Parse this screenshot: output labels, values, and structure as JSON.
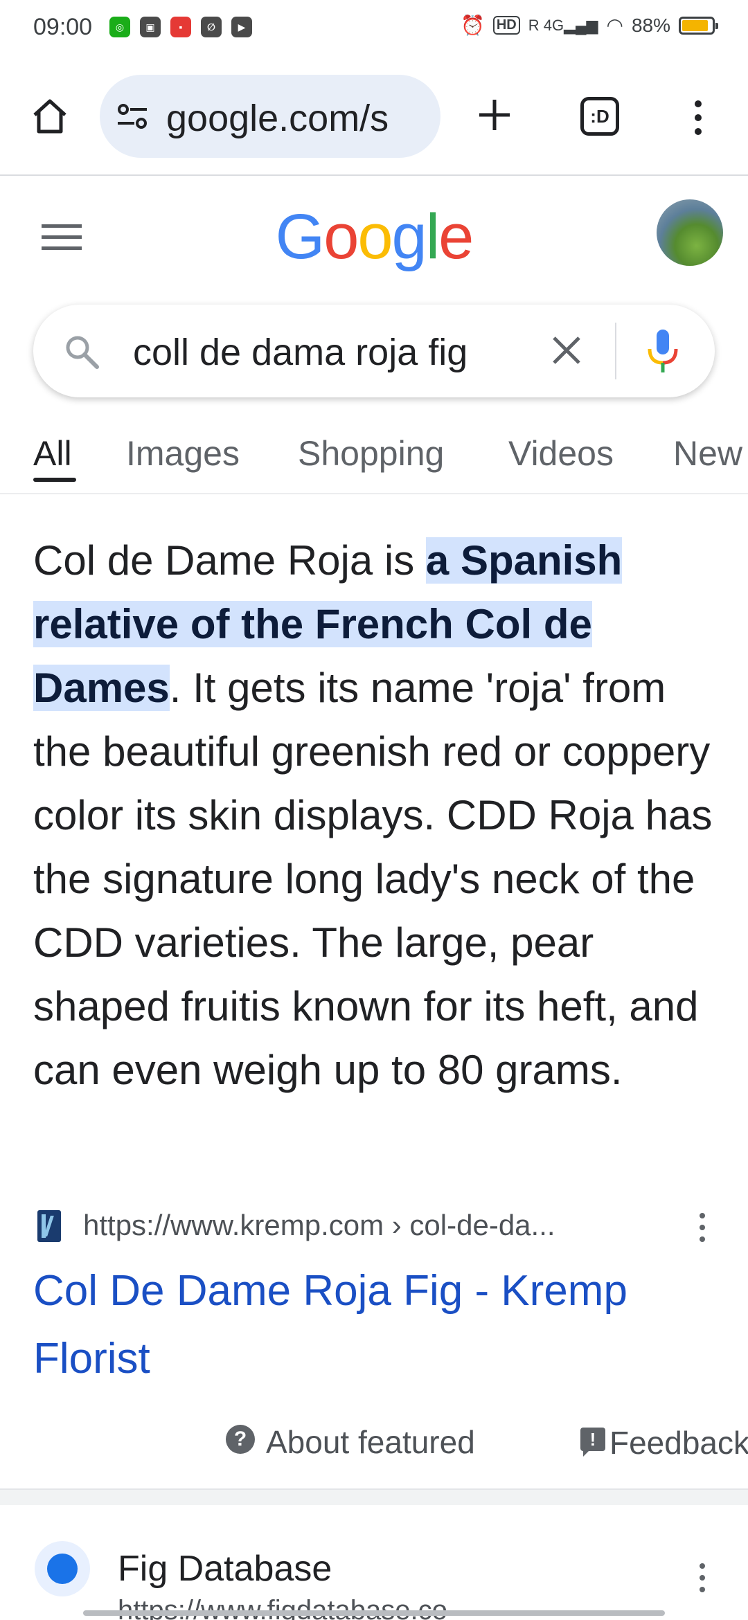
{
  "status_bar": {
    "time": "09:00",
    "battery": "88%",
    "network": "4G",
    "icons": [
      "wechat-icon",
      "app-icon",
      "app-icon",
      "app-icon",
      "app-icon",
      "alarm-icon",
      "hd-icon",
      "signal-icon",
      "wifi-icon",
      "battery-icon"
    ]
  },
  "browser": {
    "url": "google.com/s",
    "tab_count": ":D"
  },
  "google": {
    "logo": "Google",
    "logo_colors": [
      "#4285F4",
      "#EA4335",
      "#FBBC05",
      "#4285F4",
      "#34A853",
      "#EA4335"
    ]
  },
  "search": {
    "query": "coll de dama roja fig"
  },
  "tabs": [
    {
      "label": "All",
      "active": true
    },
    {
      "label": "Images"
    },
    {
      "label": "Shopping"
    },
    {
      "label": "Videos"
    },
    {
      "label": "New"
    }
  ],
  "snippet": {
    "prefix": "Col de Dame Roja is ",
    "highlight": "a Spanish relative of the French Col de Dames",
    "rest": ". It gets its name 'roja' from the beautiful greenish red or coppery color its skin displays. CDD Roja has the signature long lady's neck of the CDD varieties. The large, pear shaped fruitis known for its heft, and can even weigh up to 80 grams."
  },
  "source": {
    "url": "https://www.kremp.com › col-de-da...",
    "title": "Col De Dame Roja Fig - Kremp Florist"
  },
  "about": {
    "label": "About featured snippets",
    "feedback": "Feedback"
  },
  "next_result": {
    "title": "Fig Database",
    "url": "https://www.figdatabase.co"
  },
  "colors": {
    "link": "#1a4fc4",
    "highlight": "#d3e3fd",
    "urlbar": "#e8eef8"
  }
}
